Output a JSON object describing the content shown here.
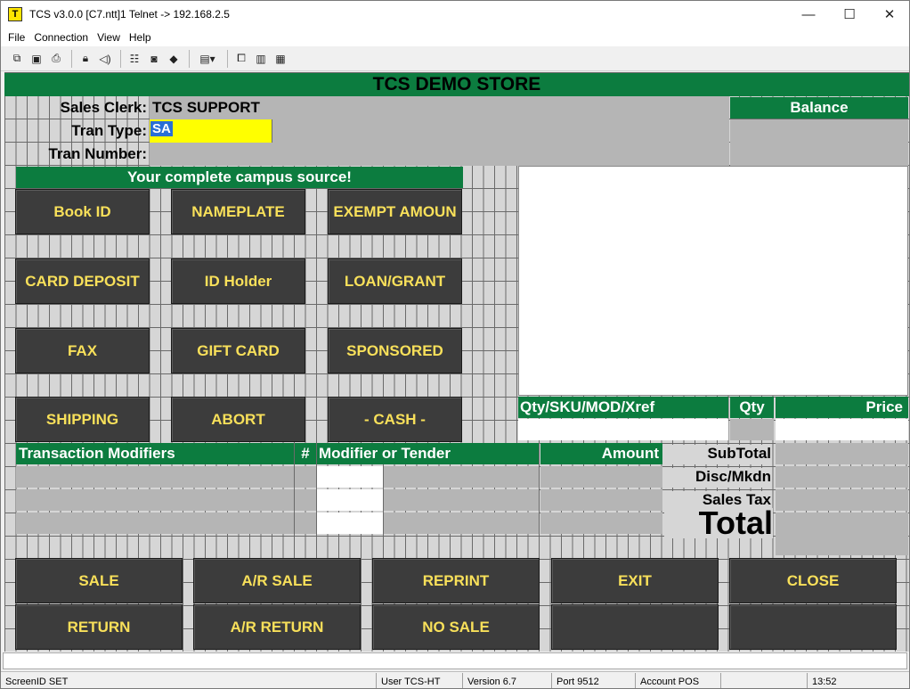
{
  "window": {
    "title": "TCS v3.0.0 [C7.ntt]1 Telnet -> 192.168.2.5",
    "app_icon": "T",
    "controls": {
      "minimize": "—",
      "maximize": "☐",
      "close": "✕"
    }
  },
  "menubar": {
    "items": [
      {
        "label": "File"
      },
      {
        "label": "Connection"
      },
      {
        "label": "View"
      },
      {
        "label": "Help"
      }
    ]
  },
  "toolbar": {
    "icons": [
      "copy-icon",
      "save-icon",
      "print-icon",
      "lock-icon",
      "sound-icon",
      "properties-icon",
      "monitor-icon",
      "book-icon",
      "window-dropdown-icon",
      "connect-icon",
      "chart-icon",
      "keypad-icon"
    ]
  },
  "terminal": {
    "store_name": "TCS DEMO STORE",
    "sales_clerk_label": "Sales Clerk:",
    "sales_clerk_value": "TCS SUPPORT",
    "tran_type_label": "Tran Type:",
    "tran_type_value": "SA",
    "tran_number_label": "Tran Number:",
    "tran_number_value": "",
    "balance_label": "Balance",
    "balance_value": "",
    "slogan": "Your complete campus source!",
    "function_buttons": [
      [
        "Book ID",
        "NAMEPLATE",
        "EXEMPT AMOUN"
      ],
      [
        "CARD DEPOSIT",
        "ID Holder",
        "LOAN/GRANT"
      ],
      [
        "FAX",
        "GIFT CARD",
        "SPONSORED"
      ],
      [
        "SHIPPING",
        "ABORT",
        "- CASH -"
      ]
    ],
    "entry_headers": {
      "qty_sku": "Qty/SKU/MOD/Xref",
      "qty": "Qty",
      "price": "Price"
    },
    "modifier_headers": {
      "transaction_modifiers": "Transaction Modifiers",
      "hash": "#",
      "modifier_tender": "Modifier or Tender",
      "amount": "Amount"
    },
    "totals": {
      "subtotal": "SubTotal",
      "disc": "Disc/Mkdn",
      "sales_tax": "Sales Tax",
      "total": "Total"
    },
    "action_buttons": [
      [
        "SALE",
        "A/R SALE",
        "REPRINT",
        "EXIT",
        "CLOSE"
      ],
      [
        "RETURN",
        "A/R RETURN",
        "NO SALE",
        "",
        ""
      ]
    ]
  },
  "statusbar": {
    "screen_id": "ScreenID SET",
    "user": "User TCS-HT",
    "version": "Version 6.7",
    "port": "Port 9512",
    "account": "Account POS",
    "blank": "",
    "time": "13:52"
  },
  "colors": {
    "header_green": "#0c7c3f",
    "button_text": "#f8e05a",
    "button_bg": "#3c3c3c",
    "highlight_field": "#ffff00"
  }
}
